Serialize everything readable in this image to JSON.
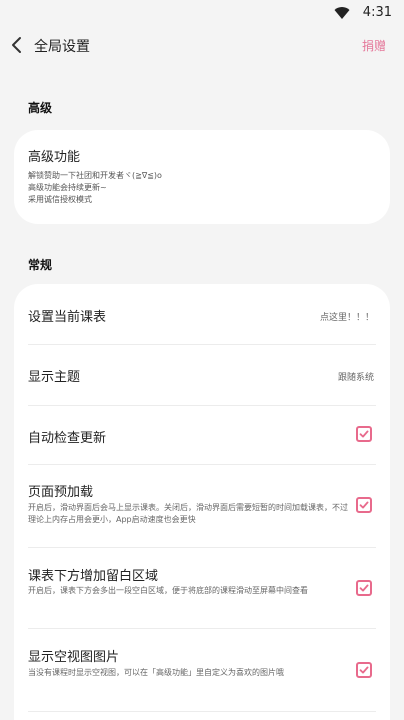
{
  "status_bar": {
    "time": "4:31"
  },
  "app_bar": {
    "title": "全局设置",
    "donate_label": "捐赠"
  },
  "sections": {
    "advanced": {
      "header": "高级",
      "item": {
        "title": "高级功能",
        "desc_lines": [
          "解锁赞助一下社团和开发者ヾ(≧∇≦)ο",
          "高级功能会持续更新~",
          "采用诚信授权模式"
        ]
      }
    },
    "general": {
      "header": "常规",
      "rows": [
        {
          "title": "设置当前课表",
          "value": "点这里！！！"
        },
        {
          "title": "显示主题",
          "value": "跟随系统"
        },
        {
          "title": "自动检查更新",
          "checked": true
        },
        {
          "title": "页面预加载",
          "desc": "开启后，滑动界面后会马上显示课表。关闭后，滑动界面后需要短暂的时间加载课表，不过理论上内存占用会更小，App启动速度也会更快",
          "checked": true
        },
        {
          "title": "课表下方增加留白区域",
          "desc": "开启后，课表下方会多出一段空白区域，便于将底部的课程滑动至屏幕中间查看",
          "checked": true
        },
        {
          "title": "显示空视图图片",
          "desc": "当没有课程时显示空视图，可以在「高级功能」里自定义为喜欢的图片哦",
          "checked": true
        }
      ]
    }
  },
  "colors": {
    "accent": "#e86a8c",
    "background": "#f4f4f4",
    "card": "#ffffff"
  },
  "icons": {
    "back": "chevron-left-icon",
    "wifi": "wifi-icon",
    "checkbox": "checkbox-checked-icon"
  }
}
